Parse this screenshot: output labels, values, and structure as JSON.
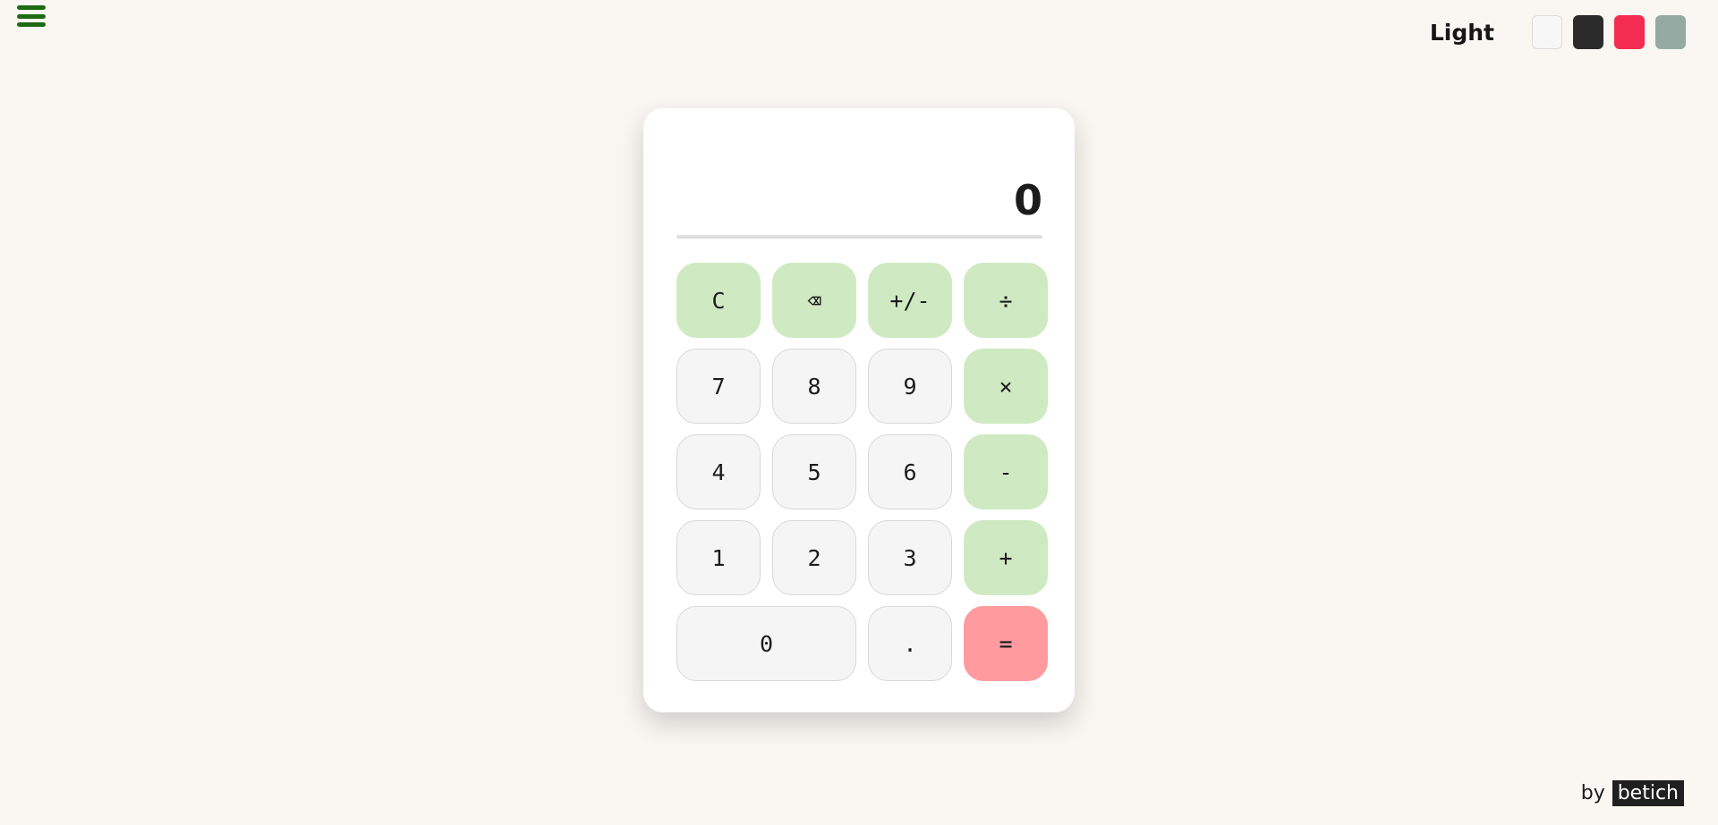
{
  "header": {
    "theme_label": "Light",
    "swatches": [
      {
        "name": "light",
        "color": "#f7f7f7"
      },
      {
        "name": "dark",
        "color": "#2b2b2b"
      },
      {
        "name": "red",
        "color": "#f42c52"
      },
      {
        "name": "sage",
        "color": "#94aaa3"
      }
    ]
  },
  "calculator": {
    "display_value": "0",
    "keys": {
      "clear": "C",
      "backspace": "⌫",
      "negate": "+/-",
      "divide": "÷",
      "seven": "7",
      "eight": "8",
      "nine": "9",
      "multiply": "×",
      "four": "4",
      "five": "5",
      "six": "6",
      "subtract": "-",
      "one": "1",
      "two": "2",
      "three": "3",
      "add": "+",
      "zero": "0",
      "decimal": ".",
      "equals": "="
    }
  },
  "footer": {
    "by_text": "by",
    "author": "betich"
  },
  "colors": {
    "background": "#faf7f3",
    "operator_key": "#cfeac2",
    "equals_key": "#ff9b9e",
    "menu_icon": "#1d6a13"
  }
}
